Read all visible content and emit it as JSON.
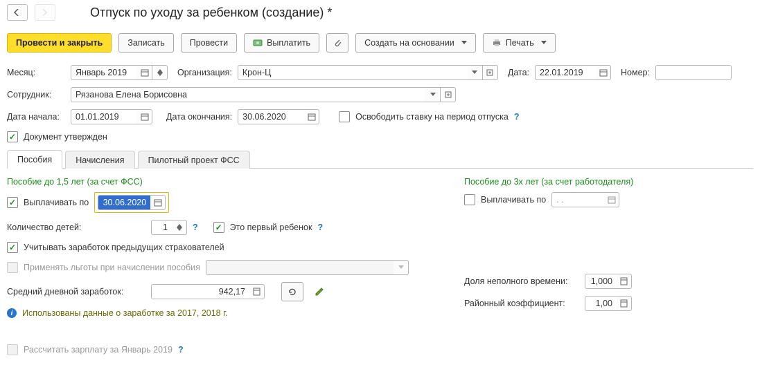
{
  "title": "Отпуск по уходу за ребенком (создание) *",
  "toolbar": {
    "run_close": "Провести и закрыть",
    "write": "Записать",
    "run": "Провести",
    "pay": "Выплатить",
    "create_based": "Создать на основании",
    "print": "Печать"
  },
  "labels": {
    "month": "Месяц:",
    "org": "Организация:",
    "date": "Дата:",
    "number": "Номер:",
    "employee": "Сотрудник:",
    "start": "Дата начала:",
    "end": "Дата окончания:",
    "release_rate": "Освободить ставку на период отпуска",
    "doc_approved": "Документ утвержден"
  },
  "fields": {
    "month": "Январь 2019",
    "org": "Крон-Ц",
    "date": "22.01.2019",
    "number": "",
    "employee": "Рязанова Елена Борисовна",
    "start": "01.01.2019",
    "end": "30.06.2020"
  },
  "tabs": [
    "Пособия",
    "Начисления",
    "Пилотный проект ФСС"
  ],
  "fss15": {
    "header": "Пособие до 1,5 лет (за счет ФСС)",
    "pay_until_label": "Выплачивать по",
    "pay_until": "30.06.2020",
    "children_label": "Количество детей:",
    "children": "1",
    "first_child_label": "Это первый ребенок",
    "prev_insurers_label": "Учитывать заработок предыдущих страхователей",
    "use_benefits_label": "Применять льготы при начислении пособия",
    "avg_label": "Средний дневной заработок:",
    "avg": "942,17",
    "info_text": "Использованы данные о заработке за  2017,  2018 г."
  },
  "fss3": {
    "header": "Пособие до 3х лет (за счет работодателя)",
    "pay_until_label": "Выплачивать по",
    "pay_until": "  .  .",
    "part_time_label": "Доля неполного времени:",
    "part_time": "1,000",
    "region_coef_label": "Районный коэффициент:",
    "region_coef": "1,00"
  },
  "footer": {
    "calc_salary_label": "Рассчитать зарплату за Январь 2019"
  }
}
